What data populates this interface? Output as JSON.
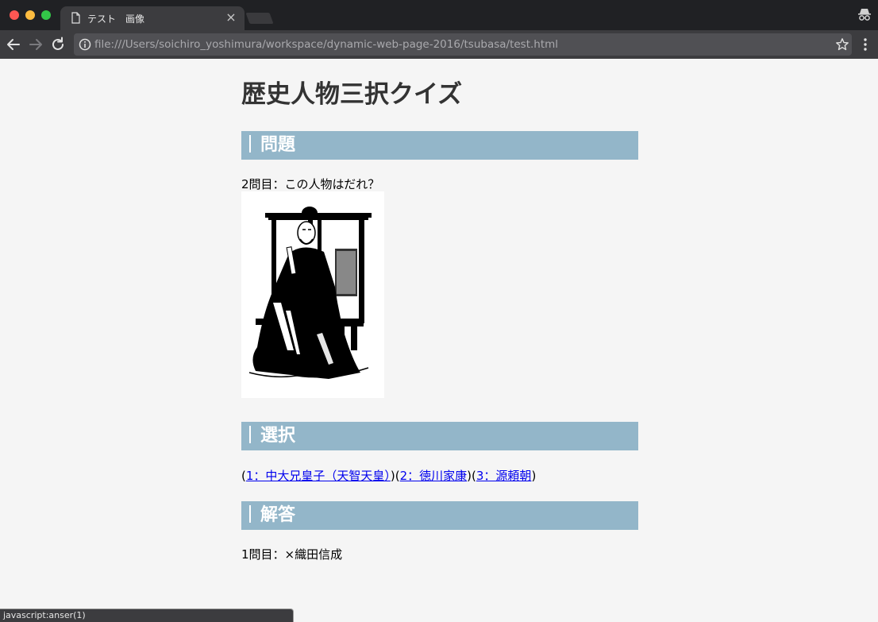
{
  "browser": {
    "tab_title": "テスト　画像",
    "tab_close": "×",
    "url": "file:///Users/soichiro_yoshimura/workspace/dynamic-web-page-2016/tsubasa/test.html",
    "status_text": "javascript:anser(1)",
    "icons": [
      "page-icon",
      "close-icon",
      "incognito-icon",
      "back-icon",
      "forward-icon",
      "reload-icon",
      "info-icon",
      "star-icon",
      "menu-icon"
    ]
  },
  "page": {
    "title": "歴史人物三択クイズ",
    "question_heading": "問題",
    "question_text": "2問目：この人物はだれ？",
    "choices_heading": "選択",
    "choices": {
      "open1": "(",
      "choice1": "1：中大兄皇子（天智天皇）",
      "sep12": ")(",
      "choice2": "2：徳川家康",
      "sep23": ")(",
      "choice3": "3：源頼朝",
      "close3": ")"
    },
    "answer_heading": "解答",
    "answer_text": "1問目：×織田信成"
  },
  "colors": {
    "section_head_bg": "#93b6c9",
    "link": "#0000ee",
    "chrome_dark": "#202124",
    "chrome_toolbar": "#3c3c3f"
  }
}
